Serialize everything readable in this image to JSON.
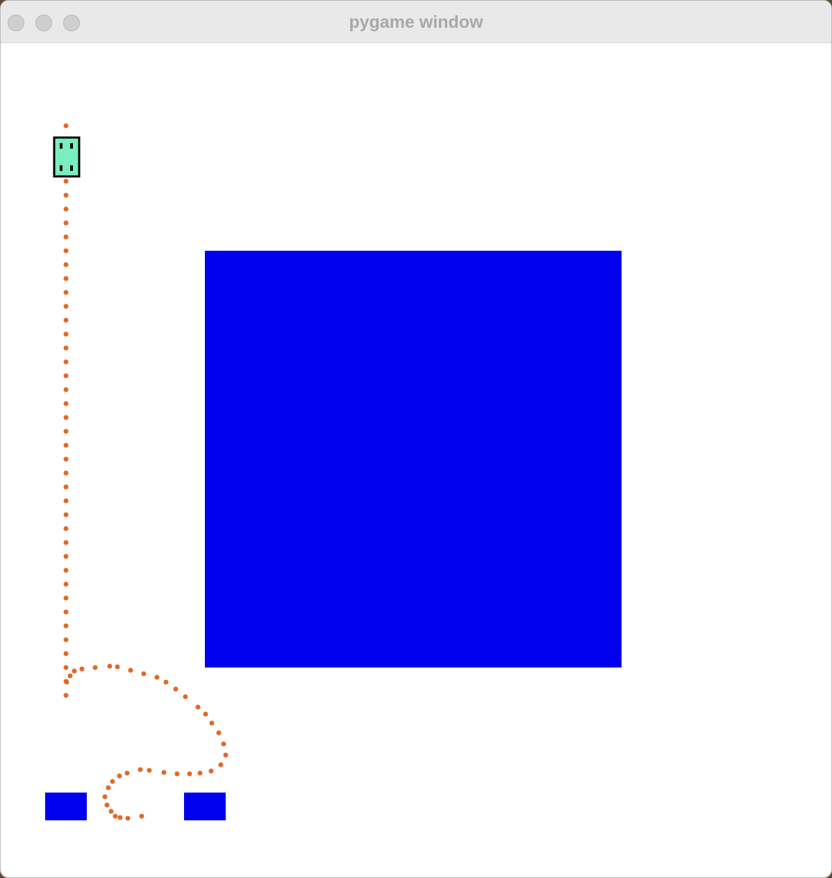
{
  "window": {
    "title": "pygame window"
  },
  "colors": {
    "obstacle": "#0000ee",
    "trail": "#e0692a",
    "robot_body": "#7aeec0",
    "robot_outline": "#000000"
  },
  "scene": {
    "obstacle_count": 3,
    "trail_dot_count": 75
  }
}
